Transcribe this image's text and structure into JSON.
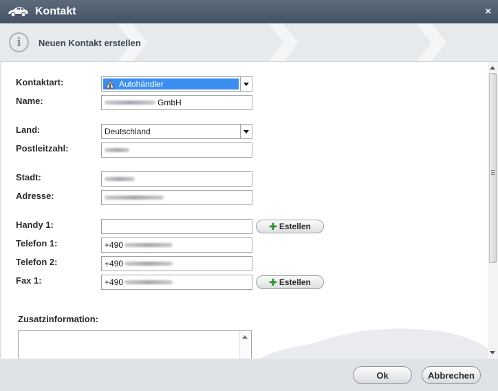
{
  "window": {
    "title": "Kontakt",
    "close_label": "×",
    "icon": "car-icon"
  },
  "step": {
    "title": "Neuen Kontakt erstellen",
    "icon": "info-icon"
  },
  "form": {
    "kontaktart": {
      "label": "Kontaktart:",
      "value": "Autohändler"
    },
    "name": {
      "label": "Name:",
      "value_suffix": "GmbH"
    },
    "land": {
      "label": "Land:",
      "value": "Deutschland"
    },
    "plz": {
      "label": "Postleitzahl:"
    },
    "stadt": {
      "label": "Stadt:"
    },
    "adresse": {
      "label": "Adresse:"
    },
    "handy1": {
      "label": "Handy 1:",
      "value": "",
      "button": "Estellen"
    },
    "telefon1": {
      "label": "Telefon 1:",
      "value_prefix": "+490"
    },
    "telefon2": {
      "label": "Telefon 2:",
      "value_prefix": "+490"
    },
    "fax1": {
      "label": "Fax 1:",
      "value_prefix": "+490",
      "button": "Estellen"
    },
    "zusatz": {
      "label": "Zusatzinformation:"
    }
  },
  "footer": {
    "ok_label": "Ok",
    "cancel_label": "Abbrechen"
  },
  "colors": {
    "titlebar": "#4e5d6e",
    "selection": "#3b8ef0",
    "plus": "#2e8b2e"
  }
}
